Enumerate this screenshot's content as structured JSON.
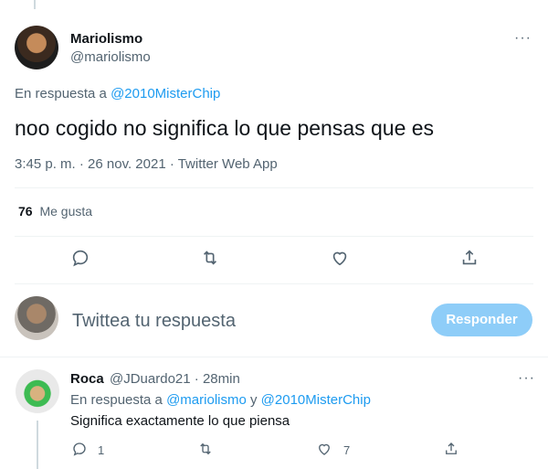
{
  "main_tweet": {
    "author_name": "Mariolismo",
    "author_handle": "@mariolismo",
    "reply_prefix": "En respuesta a",
    "reply_mention": "@2010MisterChip",
    "text": "noo cogido no significa lo que pensas que es",
    "meta": "3:45 p. m. · 26 nov. 2021 · Twitter Web App",
    "likes_count": "76",
    "likes_label": "Me gusta",
    "more": "···"
  },
  "compose": {
    "placeholder": "Twittea tu respuesta",
    "reply_button": "Responder"
  },
  "reply": {
    "author_name": "Roca",
    "handle_time": "@JDuardo21 · 28min",
    "reply_prefix": "En respuesta a",
    "mention_1": "@mariolismo",
    "conjunction": "y",
    "mention_2": "@2010MisterChip",
    "text": "Significa exactamente lo que piensa",
    "reply_count": "1",
    "like_count": "7",
    "more": "···"
  },
  "icons": [
    "reply-icon",
    "retweet-icon",
    "like-icon",
    "share-icon",
    "more-icon"
  ]
}
